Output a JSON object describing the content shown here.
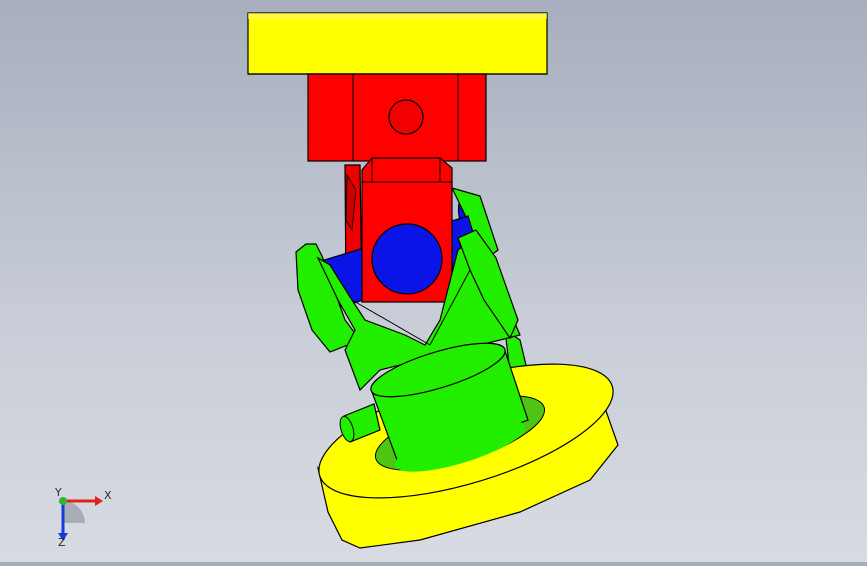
{
  "viewport": {
    "background_top": "#a7aebd",
    "background_bottom": "#d8dbe2"
  },
  "model": {
    "colors": {
      "top_flange": "#ffff00",
      "upper_yoke": "#ff0000",
      "cross_pin": "#0a14e6",
      "lower_yoke": "#22ee00",
      "bottom_flange": "#ffff00"
    }
  },
  "triad": {
    "x_label": "X",
    "y_label": "Y",
    "z_label": "Z",
    "x_color": "#e0241b",
    "y_color": "#2fb52f",
    "z_color": "#1a3ad8"
  }
}
